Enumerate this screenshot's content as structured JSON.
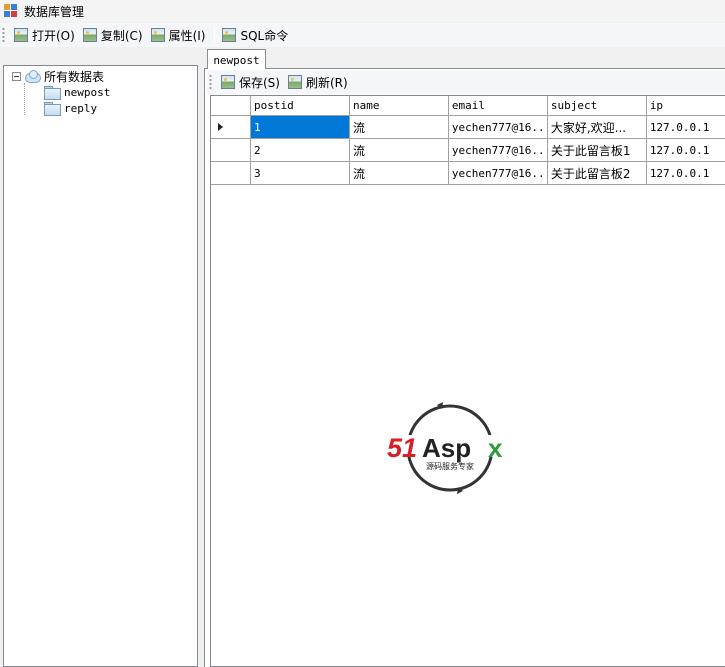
{
  "window": {
    "title": "数据库管理"
  },
  "toolbar": {
    "open_label": "打开(O)",
    "copy_label": "复制(C)",
    "properties_label": "属性(I)",
    "sql_label": "SQL命令"
  },
  "tree": {
    "root_label": "所有数据表",
    "tables": [
      {
        "label": "newpost"
      },
      {
        "label": "reply"
      }
    ]
  },
  "tabs": [
    {
      "label": "newpost"
    }
  ],
  "sub_toolbar": {
    "save_label": "保存(S)",
    "refresh_label": "刷新(R)"
  },
  "grid": {
    "columns": [
      "postid",
      "name",
      "email",
      "subject",
      "ip"
    ],
    "rows": [
      [
        "1",
        "流",
        "yechen777@16...",
        "大家好,欢迎...",
        "127.0.0.1"
      ],
      [
        "2",
        "流",
        "yechen777@16...",
        "关于此留言板1",
        "127.0.0.1"
      ],
      [
        "3",
        "流",
        "yechen777@16...",
        "关于此留言板2",
        "127.0.0.1"
      ]
    ],
    "current_row": 0,
    "selected_cell": "postid"
  },
  "watermark": {
    "brand": "51Aspx",
    "tagline": "源码服务专家"
  },
  "colors": {
    "selection": "#0078d7",
    "brand_red": "#d71f26",
    "brand_green": "#2e9b3a"
  }
}
